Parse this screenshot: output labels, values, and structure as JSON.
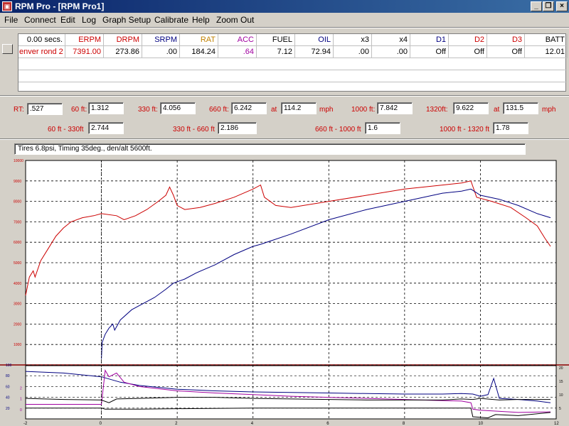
{
  "window": {
    "title": "RPM Pro - [RPM Pro1]"
  },
  "menu": [
    "File",
    "Connect",
    "Edit",
    "Log",
    "Graph Setup",
    "Calibrate",
    "Help",
    "Zoom Out"
  ],
  "grid": {
    "columns": [
      {
        "label": "0.00 secs.",
        "color": "#000000",
        "value": "enver rond 2",
        "value_color": "#cc0000"
      },
      {
        "label": "ERPM",
        "color": "#cc0000",
        "value": "7391.00",
        "value_color": "#cc0000"
      },
      {
        "label": "DRPM",
        "color": "#cc0000",
        "value": "273.86",
        "value_color": "#000000"
      },
      {
        "label": "SRPM",
        "color": "#000080",
        "value": ".00",
        "value_color": "#000000"
      },
      {
        "label": "RAT",
        "color": "#c08000",
        "value": "184.24",
        "value_color": "#000000"
      },
      {
        "label": "ACC",
        "color": "#a000a0",
        "value": ".64",
        "value_color": "#a000a0"
      },
      {
        "label": "FUEL",
        "color": "#000000",
        "value": "7.12",
        "value_color": "#000000"
      },
      {
        "label": "OIL",
        "color": "#000080",
        "value": "72.94",
        "value_color": "#000000"
      },
      {
        "label": "x3",
        "color": "#000000",
        "value": ".00",
        "value_color": "#000000"
      },
      {
        "label": "x4",
        "color": "#000000",
        "value": ".00",
        "value_color": "#000000"
      },
      {
        "label": "D1",
        "color": "#000080",
        "value": "Off",
        "value_color": "#000000"
      },
      {
        "label": "D2",
        "color": "#cc0000",
        "value": "Off",
        "value_color": "#000000"
      },
      {
        "label": "D3",
        "color": "#cc0000",
        "value": "Off",
        "value_color": "#000000"
      },
      {
        "label": "BATT",
        "color": "#000000",
        "value": "12.01",
        "value_color": "#000000"
      }
    ]
  },
  "timeslip": {
    "rt_label": "RT:",
    "rt": ".527",
    "ft60_label": "60 ft:",
    "ft60": "1.312",
    "ft330_label": "330 ft:",
    "ft330": "4.056",
    "ft660_label": "660 ft:",
    "ft660": "6.242",
    "at1_label": "at",
    "mph660": "114.2",
    "mph1_label": "mph",
    "ft1000_label": "1000 ft:",
    "ft1000": "7.842",
    "ft1320_label": "1320ft:",
    "ft1320": "9.622",
    "at2_label": "at",
    "mph1320": "131.5",
    "mph2_label": "mph"
  },
  "splits": {
    "s1_label": "60 ft - 330ft",
    "s1": "2.744",
    "s2_label": "330 ft - 660 ft",
    "s2": "2.186",
    "s3_label": "660 ft - 1000 ft",
    "s3": "1.6",
    "s4_label": "1000 ft - 1320 ft",
    "s4": "1.78"
  },
  "notes": "Tires 6.8psi, Timing 35deg., den/alt 5600ft.",
  "chart_data": {
    "type": "line",
    "x_ticks": [
      "-2",
      "0",
      "2",
      "4",
      "6",
      "8",
      "10",
      "12"
    ],
    "xlim": [
      -2,
      12
    ],
    "top_panel": {
      "y_ticks": [
        "1000",
        "2000",
        "3000",
        "4000",
        "5000",
        "6000",
        "7000",
        "8000",
        "9000",
        "10000"
      ],
      "ylim": [
        0,
        10000
      ],
      "series": [
        {
          "color": "#cc0000",
          "points": [
            [
              -2,
              3400
            ],
            [
              -1.9,
              4300
            ],
            [
              -1.8,
              4600
            ],
            [
              -1.75,
              4300
            ],
            [
              -1.6,
              5100
            ],
            [
              -1.4,
              5700
            ],
            [
              -1.2,
              6300
            ],
            [
              -1,
              6700
            ],
            [
              -0.8,
              7000
            ],
            [
              -0.5,
              7200
            ],
            [
              -0.2,
              7300
            ],
            [
              0,
              7400
            ],
            [
              0.4,
              7300
            ],
            [
              0.6,
              7100
            ],
            [
              0.9,
              7300
            ],
            [
              1.2,
              7600
            ],
            [
              1.5,
              8000
            ],
            [
              1.7,
              8300
            ],
            [
              1.8,
              8700
            ],
            [
              1.9,
              8300
            ],
            [
              2.0,
              7800
            ],
            [
              2.2,
              7600
            ],
            [
              2.6,
              7700
            ],
            [
              3.0,
              7900
            ],
            [
              3.5,
              8200
            ],
            [
              4.0,
              8600
            ],
            [
              4.2,
              8800
            ],
            [
              4.3,
              8200
            ],
            [
              4.6,
              7800
            ],
            [
              5,
              7700
            ],
            [
              6,
              8000
            ],
            [
              7,
              8300
            ],
            [
              8,
              8600
            ],
            [
              9,
              8800
            ],
            [
              9.5,
              8900
            ],
            [
              9.75,
              9000
            ],
            [
              9.9,
              8200
            ],
            [
              10.3,
              8000
            ],
            [
              10.8,
              7700
            ],
            [
              11.2,
              7200
            ],
            [
              11.5,
              6800
            ],
            [
              11.7,
              6200
            ],
            [
              11.85,
              5800
            ]
          ]
        },
        {
          "color": "#000080",
          "points": [
            [
              0,
              300
            ],
            [
              0.02,
              1100
            ],
            [
              0.1,
              1500
            ],
            [
              0.2,
              1800
            ],
            [
              0.3,
              2000
            ],
            [
              0.35,
              1700
            ],
            [
              0.5,
              2200
            ],
            [
              0.8,
              2700
            ],
            [
              1.1,
              3000
            ],
            [
              1.4,
              3300
            ],
            [
              1.7,
              3700
            ],
            [
              1.9,
              4000
            ],
            [
              2.2,
              4200
            ],
            [
              2.5,
              4500
            ],
            [
              3,
              4900
            ],
            [
              3.5,
              5400
            ],
            [
              4,
              5800
            ],
            [
              4.2,
              5900
            ],
            [
              5,
              6400
            ],
            [
              6,
              7100
            ],
            [
              7,
              7600
            ],
            [
              8,
              8000
            ],
            [
              9,
              8400
            ],
            [
              9.5,
              8500
            ],
            [
              9.75,
              8600
            ],
            [
              10,
              8300
            ],
            [
              10.5,
              8100
            ],
            [
              11,
              7800
            ],
            [
              11.5,
              7400
            ],
            [
              11.85,
              7200
            ]
          ]
        }
      ]
    },
    "bottom_panel": {
      "y_ticks_left": [
        "20",
        "40",
        "60",
        "80",
        "100"
      ],
      "y_ticks_left_b": [
        "0",
        "1",
        "2"
      ],
      "y_ticks_right": [
        "5",
        "10",
        "15",
        "20"
      ],
      "ylim": [
        0,
        100
      ],
      "series": [
        {
          "color": "#000080",
          "points": [
            [
              -2,
              88
            ],
            [
              -1,
              85
            ],
            [
              0,
              78
            ],
            [
              0.5,
              68
            ],
            [
              1,
              62
            ],
            [
              2,
              55
            ],
            [
              3,
              52
            ],
            [
              4,
              50
            ],
            [
              5,
              49
            ],
            [
              6,
              48
            ],
            [
              7,
              47
            ],
            [
              8,
              46
            ],
            [
              9,
              46
            ],
            [
              9.5,
              47
            ],
            [
              9.8,
              46
            ],
            [
              10,
              42
            ],
            [
              10.2,
              45
            ],
            [
              10.35,
              75
            ],
            [
              10.5,
              38
            ],
            [
              11,
              36
            ],
            [
              11.5,
              33
            ],
            [
              11.85,
              30
            ]
          ]
        },
        {
          "color": "#a000a0",
          "points": [
            [
              -2,
              27
            ],
            [
              -1,
              27
            ],
            [
              0,
              27
            ],
            [
              0.1,
              90
            ],
            [
              0.2,
              78
            ],
            [
              0.4,
              85
            ],
            [
              0.6,
              68
            ],
            [
              1,
              60
            ],
            [
              2,
              52
            ],
            [
              3,
              48
            ],
            [
              4,
              45
            ],
            [
              5,
              42
            ],
            [
              6,
              40
            ],
            [
              7,
              38
            ],
            [
              8,
              36
            ],
            [
              9,
              34
            ],
            [
              9.5,
              33
            ],
            [
              9.75,
              30
            ],
            [
              9.8,
              18
            ],
            [
              10,
              16
            ],
            [
              11,
              12
            ],
            [
              11.85,
              13
            ]
          ]
        },
        {
          "color": "#000000",
          "points": [
            [
              -2,
              38
            ],
            [
              -1,
              36
            ],
            [
              0,
              35
            ],
            [
              0.2,
              30
            ],
            [
              0.4,
              37
            ],
            [
              1,
              38
            ],
            [
              2,
              40
            ],
            [
              3,
              40
            ],
            [
              4,
              38
            ],
            [
              5,
              37
            ],
            [
              6,
              36
            ],
            [
              7,
              35
            ],
            [
              8,
              35
            ],
            [
              9,
              35
            ],
            [
              9.5,
              37
            ],
            [
              9.8,
              36
            ],
            [
              10,
              38
            ],
            [
              10.5,
              35
            ],
            [
              11,
              36
            ],
            [
              11.85,
              36
            ]
          ]
        },
        {
          "color": "#000000",
          "points": [
            [
              -2,
              20
            ],
            [
              0,
              20
            ],
            [
              0.1,
              18
            ],
            [
              1,
              18
            ],
            [
              2,
              19
            ],
            [
              4,
              20
            ],
            [
              6,
              20
            ],
            [
              8,
              20
            ],
            [
              9.75,
              20
            ],
            [
              9.8,
              4
            ],
            [
              10.2,
              2
            ],
            [
              10.4,
              8
            ],
            [
              11,
              6
            ],
            [
              11.85,
              12
            ]
          ]
        }
      ]
    }
  }
}
